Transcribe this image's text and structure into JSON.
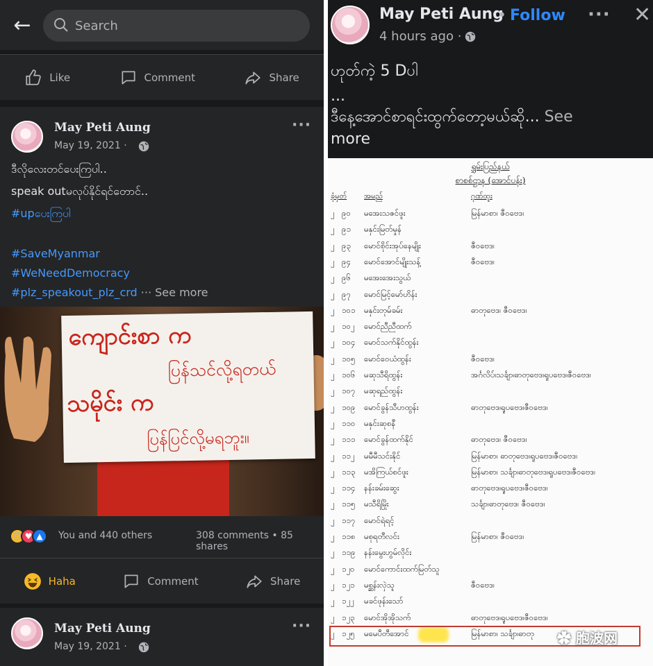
{
  "left_panel": {
    "search": {
      "placeholder": "Search"
    },
    "actions_top": {
      "like": "Like",
      "comment": "Comment",
      "share": "Share"
    },
    "post": {
      "author": "May Peti Aung",
      "date": "May 19, 2021 ·",
      "lines": [
        "ဒီလိုလေးတင်ပေးကြပါ..",
        "speak outမလုပ်နိုင်ရင်တောင်.."
      ],
      "hashtag_line": "#upပေးကြပါ",
      "hashtags": [
        "#SaveMyanmar",
        "#WeNeedDemocracy",
        "#plz_speakout_plz_crd"
      ],
      "see_more": "··· See more",
      "sign_lines": [
        "ကျောင်းစာ က",
        "ပြန်သင်လို့ရတယ်",
        "သမိုင်း က",
        "ပြန်ပြင်လို့မရဘူး။"
      ],
      "reactions_text": "You and 440 others",
      "counts_text": "308 comments • 85 shares"
    },
    "actions_bottom": {
      "haha": "Haha",
      "comment": "Comment",
      "share": "Share"
    },
    "post2": {
      "author": "May Peti Aung",
      "date": "May 19, 2021 ·"
    }
  },
  "right_panel": {
    "author": "May Peti Aung",
    "follow": "Follow",
    "time": "4 hours ago ·",
    "line1": "ဟုတ်ကဲ့ 5 Dပါ",
    "line2": "...",
    "line3": "ဒီနေ့အောင်စာရင်းထွက်တော့မယ်ဆို...",
    "see_more": "See",
    "see_more2": "more",
    "doc": {
      "title1": "ရွှမ်းပြည်နယ်",
      "title2": "စာစစ်ဌာန (အောင်ပန်း)",
      "headers": [
        "ခုံမှတ်",
        "အမည်",
        "ဂုဏ်ထူး"
      ],
      "rows": [
        [
          "၂",
          "၉၀",
          "မအေးသဇင်ဖူး",
          "မြန်မာစာ၊ ဇီဝဗေဒ၊"
        ],
        [
          "၂",
          "၉၁",
          "မနှင်းမြတ်မှုန်",
          ""
        ],
        [
          "၂",
          "၉၃",
          "မောင်စိုင်းအုပ်နေမျိုး",
          "ဇီဝဗေဒ၊"
        ],
        [
          "၂",
          "၉၄",
          "မောင်အောင်မျိုးသန့်",
          "ဇီဝဗေဒ၊"
        ],
        [
          "၂",
          "၉၆",
          "မအေးအေးသွယ်",
          ""
        ],
        [
          "၂",
          "၉၇",
          "မောင်မြင့်မော်ဟိန်း",
          ""
        ],
        [
          "၂",
          "၁၀၁",
          "မနှင်းတုမ်ခမ်း",
          "ဓာတုဗေဒ၊ ဇီဝဗေဒ၊"
        ],
        [
          "၂",
          "၁၀၂",
          "မောင်ညီညီထက်",
          ""
        ],
        [
          "၂",
          "၁၀၄",
          "မောင်သက်နိုင်ထွန်း",
          ""
        ],
        [
          "၂",
          "၁၀၅",
          "မောင်ဝေယံထွန်း",
          "ဇီဝဗေဒ၊"
        ],
        [
          "၂",
          "၁၀၆",
          "မဆုသီရိထွန်း",
          "အင်္ဂလိပ်၊သင်္ချာ၊ဓာတုဗေဒ၊ရူပဗေဒ၊ဇီဝဗေဒ၊"
        ],
        [
          "၂",
          "၁၀၇",
          "မဆုရည်ထွန်း",
          ""
        ],
        [
          "၂",
          "၁၀၉",
          "မောင်ခွန်သီဟထွန်း",
          "ဓာတုဗေဒ၊ရူပဗေဒ၊ဇီဝဗေဒ၊"
        ],
        [
          "၂",
          "၁၁၀",
          "မနှင်းဆုစနီ",
          ""
        ],
        [
          "၂",
          "၁၁၁",
          "မောင်ခွန်ထက်နိုင်",
          "ဓာတုဗေဒ၊ ဇီဝဗေဒ၊"
        ],
        [
          "၂",
          "၁၁၂",
          "မမီမီသင်းနိုင်",
          "မြန်မာစာ၊ ဓာတုဗေဒ၊ရူပဗေဒ၊ဇီဝဗေဒ၊"
        ],
        [
          "၂",
          "၁၁၃",
          "မအိကြယ်စင်ဖူး",
          "မြန်မာစာ၊ သင်္ချာ၊ဓာတုဗေဒ၊ရူပဗေဒ၊ဇီဝဗေဒ၊"
        ],
        [
          "၂",
          "၁၁၄",
          "နန်းခမ်းဆွေး",
          "ဓာတုဗေဒ၊ရူပဗေဒ၊ဇီဝဗေဒ၊"
        ],
        [
          "၂",
          "၁၁၅",
          "မသီရိမြိုး",
          "သင်္ချာ၊ဓာတုဗေဒ၊ ဇီဝဗေဒ၊"
        ],
        [
          "၂",
          "၁၁၇",
          "မောင်ရဲရင့်",
          ""
        ],
        [
          "၂",
          "၁၁၈",
          "မစုရတီလင်း",
          "မြန်မာစာ၊ ဇီဝဗေဒ၊"
        ],
        [
          "၂",
          "၁၁၉",
          "နန်းမွေးဟွမ်လိုင်း",
          ""
        ],
        [
          "၂",
          "၁၂၀",
          "မောင်ကောင်းထက်မြတ်သူ",
          ""
        ],
        [
          "၂",
          "၁၂၁",
          "မစ္ဆန်းလှဲသူ",
          "ဇီဝဗေဒ၊"
        ],
        [
          "၂",
          "၁၂၂",
          "မခင်ဖုန်းသော်",
          ""
        ],
        [
          "၂",
          "၁၂၃",
          "မောင်အိုအိုသက်",
          "ဓာတုဗေဒ၊ရူပဗေဒ၊ဇီဝဗေဒ၊"
        ],
        [
          "၂",
          "၁၂၅",
          "မမေပီတီအောင်",
          "မြန်မာစာ၊ သင်္ချာ၊ဓာတု"
        ]
      ]
    },
    "watermark": "胞波网"
  },
  "colors": {
    "fb_dark": "#18191a",
    "fb_card": "#242526",
    "link_blue": "#2d88ff",
    "hashtag_blue": "#4599ff",
    "sign_red": "#c9251c",
    "highlight_red": "#c23b2d"
  }
}
